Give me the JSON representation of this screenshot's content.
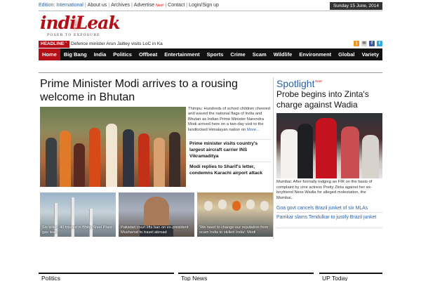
{
  "topbar": {
    "edition": "Edition: International",
    "links": [
      "About us",
      "Archives",
      "Advertise",
      "Contact",
      "Login/Sign up"
    ],
    "new_tag": "New!",
    "date": "Sunday 15 June, 2014"
  },
  "logo": {
    "name": "indiLeak",
    "tagline": "POSER TO EXPOSURE"
  },
  "ticker": {
    "label": "HEADLINES",
    "text": "Defence minister Arun Jaitley visits LoC in Ka"
  },
  "social_icons": [
    "rss-icon",
    "mail-icon",
    "facebook-icon",
    "twitter-icon"
  ],
  "nav": {
    "items": [
      "Home",
      "Big Bang",
      "India",
      "Politics",
      "Offbeat",
      "Entertainment",
      "Sports",
      "Crime",
      "Scam",
      "Wildlife",
      "Environment",
      "Global",
      "Variety"
    ],
    "active": "Home"
  },
  "main_story": {
    "title": "Prime Minister Modi arrives to a rousing welcome in Bhutan",
    "excerpt": "Thimpu: Hundreds of school children cheered and waved the national flags of India and Bhutan as Indian Prime Minister Narendra Modi arrived here on a two-day visit to the landlocked Himalayan nation on",
    "more": "More..."
  },
  "side_headlines": [
    "Prime minister visits country's largest aircraft carrier INS Vikramaditya",
    "Modi replies to Sharif's letter, condemns Karachi airport attack"
  ],
  "thumbnails": [
    {
      "caption": "Six killed, 40 injured in Bhilai Steel Plant gas leak"
    },
    {
      "caption": "Pakistan court lifts ban on ex-president Musharraf to travel abroad"
    },
    {
      "caption": "'We need to change our reputation from scam India to skilled India': Modi"
    }
  ],
  "spotlight": {
    "title": "Spotlight",
    "new_tag": "New!",
    "headline": "Probe begins into Zinta's charge against Wadia",
    "excerpt": "Mumbai: After formally lodging an FIR on the basis of complaint by cine actress Preity Zinta against her ex-boyfriend Ness Wadia for alleged molestation, the Mumbai..",
    "links": [
      "Goa govt cancels Brazil junket of six MLAs",
      "Parrikar slams Tendulkar to justify Brazil junket"
    ]
  },
  "sections": [
    "Politics",
    "Top News",
    "UP Today"
  ],
  "colors": {
    "brand_red": "#b40f16",
    "nav_bg": "#111111",
    "link_blue": "#2a62a8"
  }
}
